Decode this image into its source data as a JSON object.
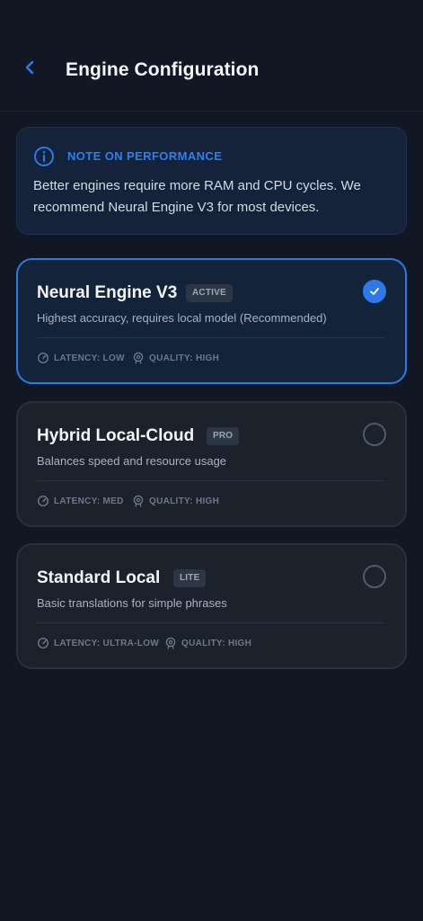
{
  "header": {
    "title": "Engine Configuration",
    "back_icon": "chevron-left-icon"
  },
  "note": {
    "icon": "info-icon",
    "title": "NOTE ON PERFORMANCE",
    "body": "Better engines require more RAM and CPU cycles. We recommend Neural Engine V3 for most devices."
  },
  "engines": [
    {
      "name": "Neural Engine V3",
      "badge": "ACTIVE",
      "description": "Highest accuracy, requires local model (Recommended)",
      "latency": "LATENCY: LOW",
      "quality": "QUALITY: HIGH",
      "selected": true
    },
    {
      "name": "Hybrid Local-Cloud",
      "badge": "PRO",
      "description": "Balances speed and resource usage",
      "latency": "LATENCY: MED",
      "quality": "QUALITY: HIGH",
      "selected": false
    },
    {
      "name": "Standard Local",
      "badge": "LITE",
      "description": "Basic translations for simple phrases",
      "latency": "LATENCY: ULTRA-LOW",
      "quality": "QUALITY: HIGH",
      "selected": false
    }
  ],
  "colors": {
    "background": "#111823",
    "accent": "#2b7ae8",
    "card": "#1b222c"
  }
}
